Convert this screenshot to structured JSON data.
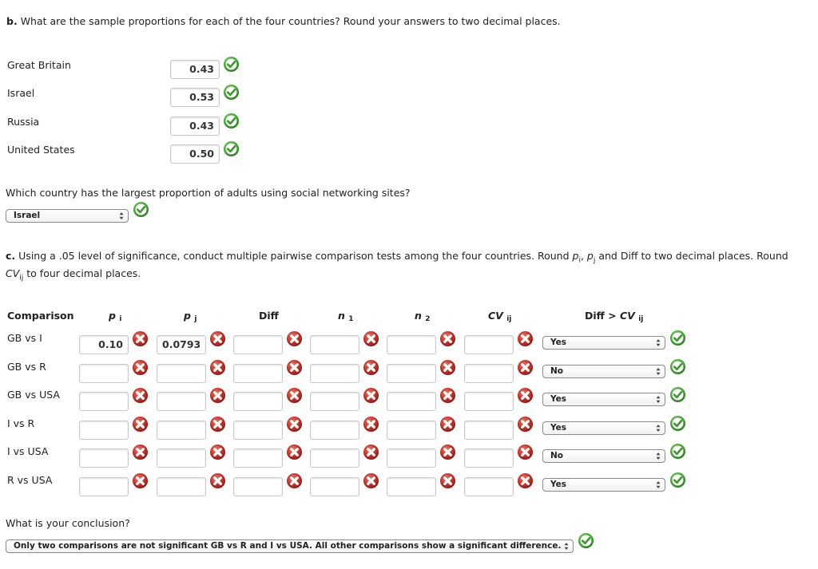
{
  "part_b": {
    "prefix": "b.",
    "question": "What are the sample proportions for each of the four countries? Round your answers to two decimal places.",
    "rows": [
      {
        "country": "Great Britain",
        "value": "0.43",
        "status": "correct"
      },
      {
        "country": "Israel",
        "value": "0.53",
        "status": "correct"
      },
      {
        "country": "Russia",
        "value": "0.43",
        "status": "correct"
      },
      {
        "country": "United States",
        "value": "0.50",
        "status": "correct"
      }
    ],
    "largest_question": "Which country has the largest proportion of adults using social networking sites?",
    "largest_answer": "Israel",
    "largest_status": "correct"
  },
  "part_c": {
    "prefix": "c.",
    "question_line1_a": "Using a .05 level of significance, conduct multiple pairwise comparison tests among the four countries. Round ",
    "p_symbol": "p",
    "sub_i": "i",
    "sub_j": "j",
    "sub_ij": "ij",
    "question_line1_b": " and Diff to two decimal places. Round",
    "cv_symbol": "CV",
    "question_line2": " to four decimal places.",
    "headers": {
      "comparison": "Comparison",
      "pi": "p",
      "pi_sub": "i",
      "pj": "p",
      "pj_sub": "j",
      "diff": "Diff",
      "n1": "n",
      "n1_sub": "1",
      "n2": "n",
      "n2_sub": "2",
      "cv": "CV",
      "cv_sub": "ij",
      "test": "Diff > ",
      "test_cv": "CV",
      "test_sub": "ij"
    },
    "rows": [
      {
        "comparison": "GB vs I",
        "pi": "0.10",
        "pj": "0.0793",
        "diff": "",
        "n1": "",
        "n2": "",
        "cv": "",
        "significant": "Yes"
      },
      {
        "comparison": "GB vs R",
        "pi": "",
        "pj": "",
        "diff": "",
        "n1": "",
        "n2": "",
        "cv": "",
        "significant": "No"
      },
      {
        "comparison": "GB vs USA",
        "pi": "",
        "pj": "",
        "diff": "",
        "n1": "",
        "n2": "",
        "cv": "",
        "significant": "Yes"
      },
      {
        "comparison": "I vs R",
        "pi": "",
        "pj": "",
        "diff": "",
        "n1": "",
        "n2": "",
        "cv": "",
        "significant": "Yes"
      },
      {
        "comparison": "I vs USA",
        "pi": "",
        "pj": "",
        "diff": "",
        "n1": "",
        "n2": "",
        "cv": "",
        "significant": "No"
      },
      {
        "comparison": "R vs USA",
        "pi": "",
        "pj": "",
        "diff": "",
        "n1": "",
        "n2": "",
        "cv": "",
        "significant": "Yes"
      }
    ],
    "field_status": "incorrect",
    "select_status": "correct",
    "conclusion_question": "What is your conclusion?",
    "conclusion_answer": "Only two comparisons are not significant GB vs R and I vs USA. All other comparisons show a significant difference.",
    "conclusion_status": "correct"
  },
  "colors": {
    "correct": "#3f9a2e",
    "incorrect": "#b3261e"
  }
}
